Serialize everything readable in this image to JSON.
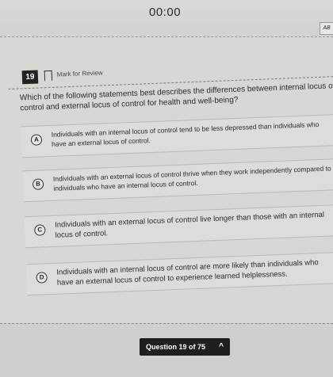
{
  "timer": "00:00",
  "corner_badge": "AB",
  "question": {
    "number": "19",
    "mark_label": "Mark for Review",
    "stem": "Which of the following statements best describes the differences between internal locus of control and external locus of control for health and well-being?",
    "options": [
      {
        "letter": "A",
        "text": "Individuals with an internal locus of control tend to be less depressed than individuals who have an external locus of control."
      },
      {
        "letter": "B",
        "text": "Individuals with an external locus of control thrive when they work independently compared to individuals who have an internal locus of control."
      },
      {
        "letter": "C",
        "text": "Individuals with an external locus of control live longer than those with an internal locus of control."
      },
      {
        "letter": "D",
        "text": "Individuals with an internal locus of control are more likely than individuals who have an external locus of control to experience learned helplessness."
      }
    ]
  },
  "nav": {
    "label": "Question 19 of 75",
    "chevron": "^"
  }
}
